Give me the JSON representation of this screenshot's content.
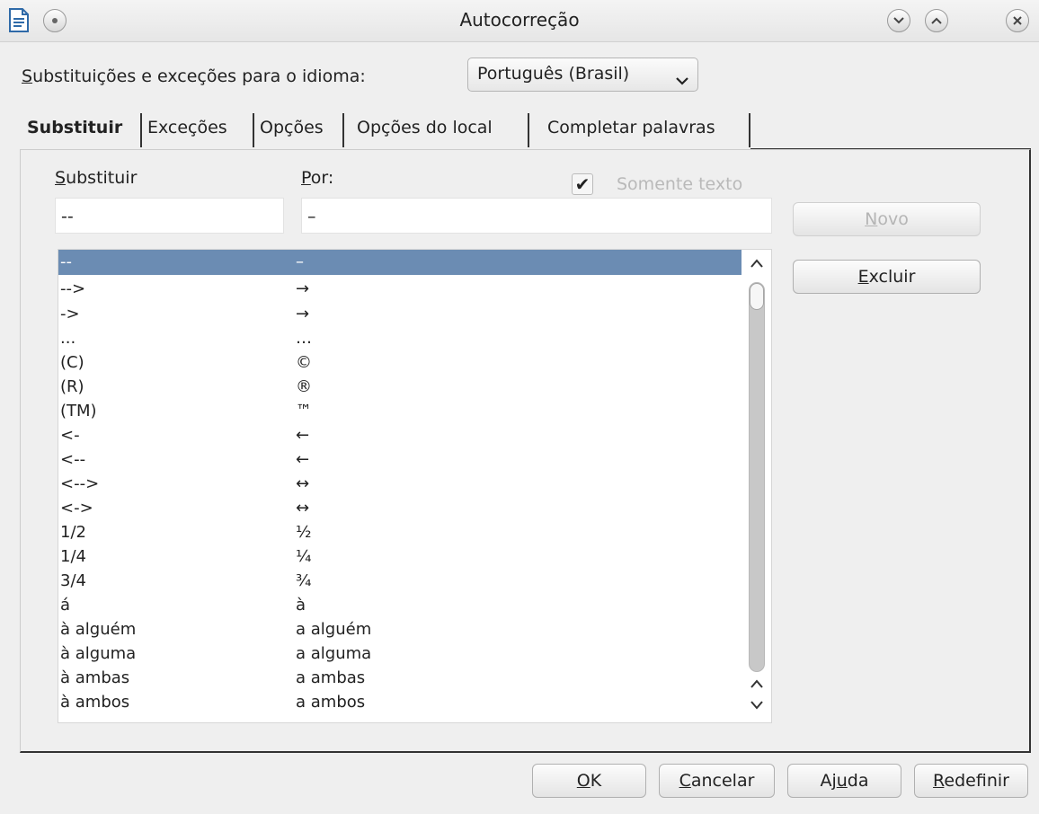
{
  "window": {
    "title": "Autocorreção",
    "icons": [
      "document-icon",
      "pin-icon",
      "minimize-icon",
      "maximize-icon",
      "close-icon"
    ]
  },
  "language": {
    "label_ul": "S",
    "label_rest": "ubstituições e exceções para o idioma:",
    "selected": "Português (Brasil)"
  },
  "tabs": [
    {
      "label": "Substituir",
      "active": true
    },
    {
      "label": "Exceções",
      "active": false
    },
    {
      "label": "Opções",
      "active": false
    },
    {
      "label": "Opções do local",
      "active": false
    },
    {
      "label": "Completar palavras",
      "active": false
    }
  ],
  "replace": {
    "col1_ul": "S",
    "col1_rest": "ubstituir",
    "col2_ul": "P",
    "col2_rest": "or:",
    "text_only_label": "Somente texto",
    "text_only_checked": true,
    "replace_value": "--",
    "with_value": "–",
    "new_ul": "N",
    "new_rest": "ovo",
    "delete_ul": "E",
    "delete_rest": "xcluir"
  },
  "list": [
    {
      "from": "--",
      "to": "–"
    },
    {
      "from": "-->",
      "to": "→"
    },
    {
      "from": "->",
      "to": "→"
    },
    {
      "from": "...",
      "to": "…"
    },
    {
      "from": "(C)",
      "to": "©"
    },
    {
      "from": "(R)",
      "to": "®"
    },
    {
      "from": "(TM)",
      "to": "™"
    },
    {
      "from": "<-",
      "to": "←"
    },
    {
      "from": "<--",
      "to": "←"
    },
    {
      "from": "<-->",
      "to": "↔"
    },
    {
      "from": "<->",
      "to": "↔"
    },
    {
      "from": "1/2",
      "to": "½"
    },
    {
      "from": "1/4",
      "to": "¼"
    },
    {
      "from": "3/4",
      "to": "¾"
    },
    {
      "from": "á",
      "to": "à"
    },
    {
      "from": "à alguém",
      "to": "a alguém"
    },
    {
      "from": "à alguma",
      "to": "a alguma"
    },
    {
      "from": "à ambas",
      "to": "a ambas"
    },
    {
      "from": "à ambos",
      "to": "a ambos"
    }
  ],
  "footer": {
    "ok_ul": "O",
    "ok_rest": "K",
    "cancel_ul": "C",
    "cancel_rest": "ancelar",
    "help_a": "Aj",
    "help_ul": "u",
    "help_b": "da",
    "reset_ul": "R",
    "reset_rest": "edefinir"
  }
}
